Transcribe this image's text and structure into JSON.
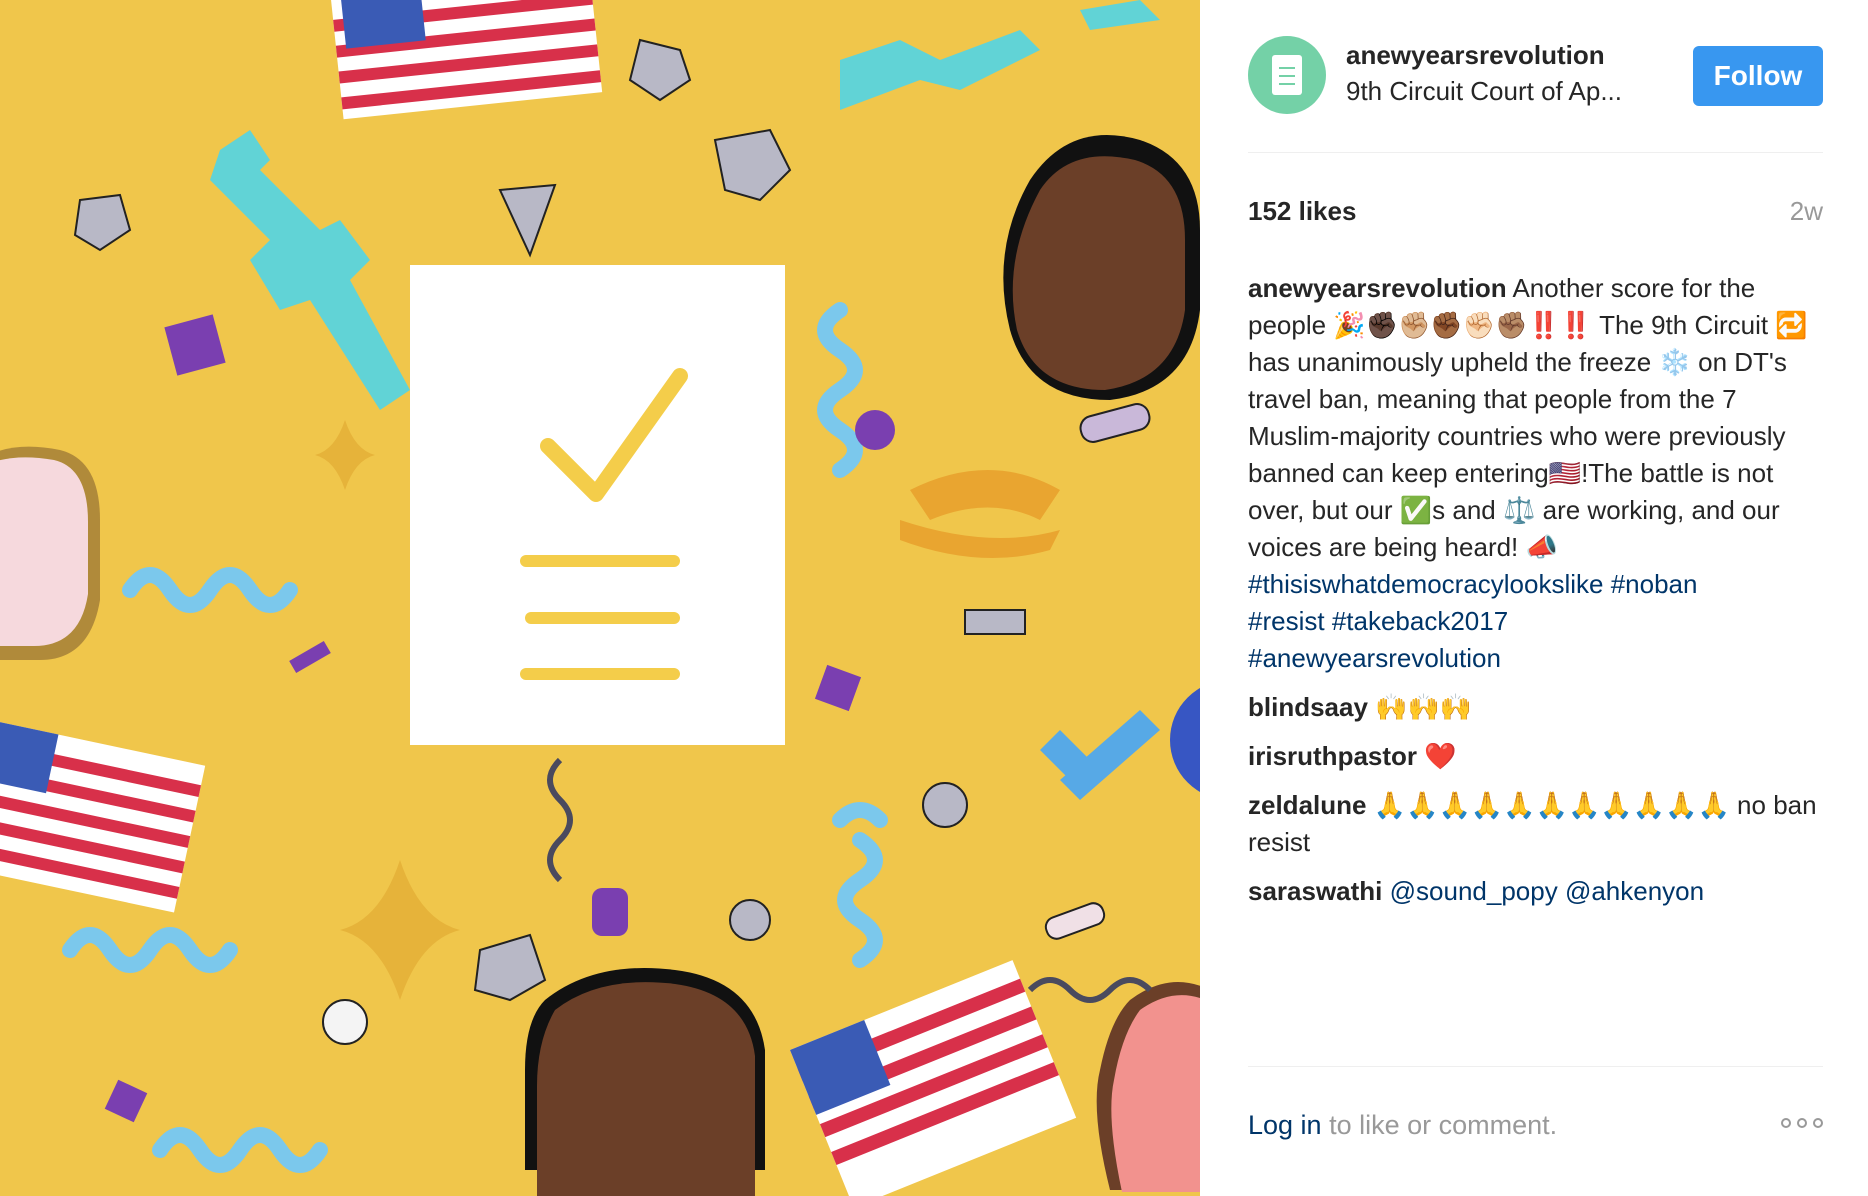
{
  "post": {
    "username": "anewyearsrevolution",
    "location": "9th Circuit Court of Ap...",
    "follow_label": "Follow",
    "likes": "152 likes",
    "age": "2w",
    "caption": {
      "author": "anewyearsrevolution",
      "text_1": "Another score for the people",
      "emoji_1": "🎉✊🏿✊🏼✊🏾✊🏻✊🏽‼️‼️",
      "text_2": "The 9th Circuit",
      "emoji_2": "🔁",
      "text_3": "has unanimously upheld the freeze",
      "emoji_3": "❄️",
      "text_4": "on DT's travel ban, meaning that people from the 7 Muslim-majority countries who were previously banned can keep entering",
      "emoji_4": "🇺🇸",
      "text_5": "!The battle is not over, but our",
      "emoji_5": "✅",
      "text_6": "s and",
      "emoji_6": "⚖️",
      "text_7": "are working, and our voices are being heard!",
      "emoji_7": "📣",
      "hashtags": [
        "#thisiswhatdemocracylookslike",
        "#noban",
        "#resist",
        "#takeback2017",
        "#anewyearsrevolution"
      ]
    },
    "comments": [
      {
        "author": "blindsaay",
        "text": "🙌🙌🙌"
      },
      {
        "author": "irisruthpastor",
        "text": "❤️"
      },
      {
        "author": "zeldalune",
        "text": "🙏🙏🙏🙏🙏🙏🙏🙏🙏🙏🙏 no ban resist"
      },
      {
        "author": "saraswathi",
        "text": "@sound_popy @ahkenyon"
      }
    ],
    "footer": {
      "login_label": "Log in",
      "rest": "to like or comment."
    }
  },
  "icons": {
    "avatar": "document-avatar-icon",
    "more": "more-options-icon",
    "photo_check": "checkmark-icon"
  },
  "colors": {
    "photo_bg": "#f0c64b",
    "follow_bg": "#3897f0",
    "link": "#003569",
    "avatar_bg": "#74d1a7"
  }
}
